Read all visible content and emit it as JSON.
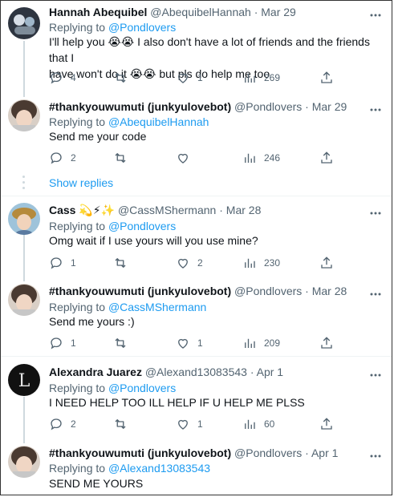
{
  "tweets": [
    {
      "name": "Hannah Abequibel",
      "handle": "@AbequibelHannah",
      "date": "Mar 29",
      "reply_prefix": "Replying to",
      "reply_to": "@Pondlovers",
      "text_line1": "I'll help you 😭😭 I also don't have a lot of friends and the friends that I",
      "text_line2": "have won't do it 😭😭 but pls do help me too",
      "replies": "4",
      "retweets": "",
      "likes": "1",
      "views": "269"
    },
    {
      "name": "#thankyouwumuti (junkyulovebot)",
      "handle": "@Pondlovers",
      "date": "Mar 29",
      "reply_prefix": "Replying to",
      "reply_to": "@AbequibelHannah",
      "text_line1": "Send me your code",
      "replies": "2",
      "retweets": "",
      "likes": "",
      "views": "246"
    },
    {
      "name": "Cass 💫⚡✨",
      "handle": "@CassMShermann",
      "date": "Mar 28",
      "reply_prefix": "Replying to",
      "reply_to": "@Pondlovers",
      "text_line1": "Omg wait if I use yours will you use mine?",
      "replies": "1",
      "retweets": "",
      "likes": "2",
      "views": "230"
    },
    {
      "name": "#thankyouwumuti (junkyulovebot)",
      "handle": "@Pondlovers",
      "date": "Mar 28",
      "reply_prefix": "Replying to",
      "reply_to": "@CassMShermann",
      "text_line1": "Send me yours :)",
      "replies": "1",
      "retweets": "",
      "likes": "1",
      "views": "209"
    },
    {
      "name": "Alexandra Juarez",
      "handle": "@Alexand13083543",
      "date": "Apr 1",
      "reply_prefix": "Replying to",
      "reply_to": "@Pondlovers",
      "text_line1": "I NEED HELP TOO ILL HELP IF U HELP ME PLSS",
      "replies": "2",
      "retweets": "",
      "likes": "1",
      "views": "60"
    },
    {
      "name": "#thankyouwumuti (junkyulovebot)",
      "handle": "@Pondlovers",
      "date": "Apr 1",
      "reply_prefix": "Replying to",
      "reply_to": "@Alexand13083543",
      "text_line1": "SEND ME YOURS"
    }
  ],
  "show_replies": "Show replies",
  "separator": "·",
  "icons": {
    "reply": "reply-icon",
    "retweet": "retweet-icon",
    "like": "heart-icon",
    "views": "views-chart-icon",
    "share": "share-icon",
    "more": "more-icon"
  },
  "colors": {
    "link": "#1d9bf0",
    "muted": "#536471",
    "text": "#0f1419",
    "thread_line": "#cfd9de"
  }
}
